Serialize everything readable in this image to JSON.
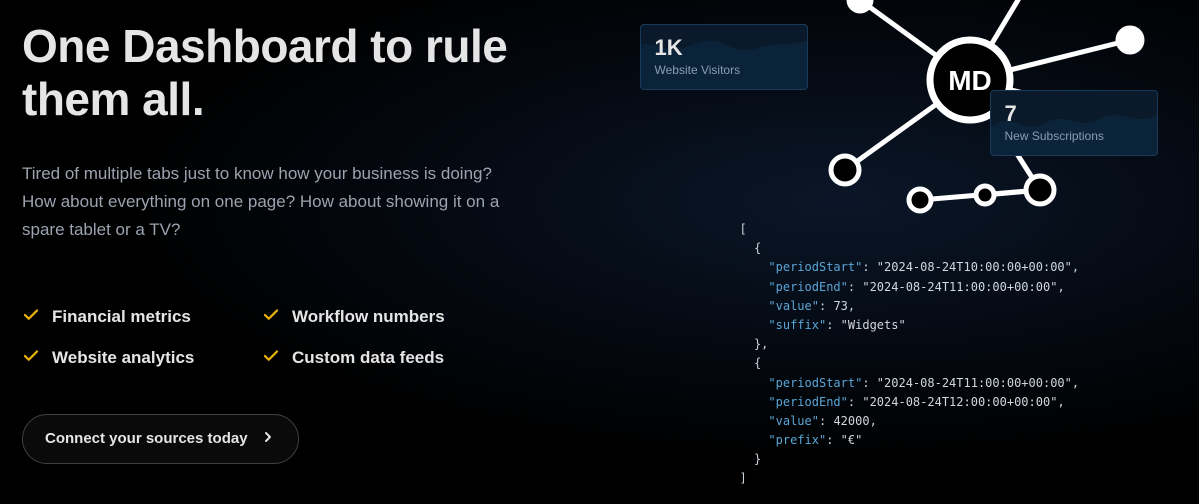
{
  "headline": "One Dashboard to rule them all.",
  "subtext": "Tired of multiple tabs just to know how your business is doing? How about everything on one page? How about showing it on a spare tablet or a TV?",
  "features": [
    "Financial metrics",
    "Workflow numbers",
    "Website analytics",
    "Custom data feeds"
  ],
  "cta_label": "Connect your sources today",
  "stats": {
    "card1": {
      "value": "1K",
      "label": "Website Visitors"
    },
    "card2": {
      "value": "7",
      "label": "New Subscriptions"
    }
  },
  "brand_badge": "MD",
  "code_sample": {
    "rows": [
      {
        "periodStart": "2024-08-24T10:00:00+00:00",
        "periodEnd": "2024-08-24T11:00:00+00:00",
        "value": "73",
        "suffix": "Widgets"
      },
      {
        "periodStart": "2024-08-24T11:00:00+00:00",
        "periodEnd": "2024-08-24T12:00:00+00:00",
        "value": "42000",
        "prefix": "€"
      }
    ]
  }
}
